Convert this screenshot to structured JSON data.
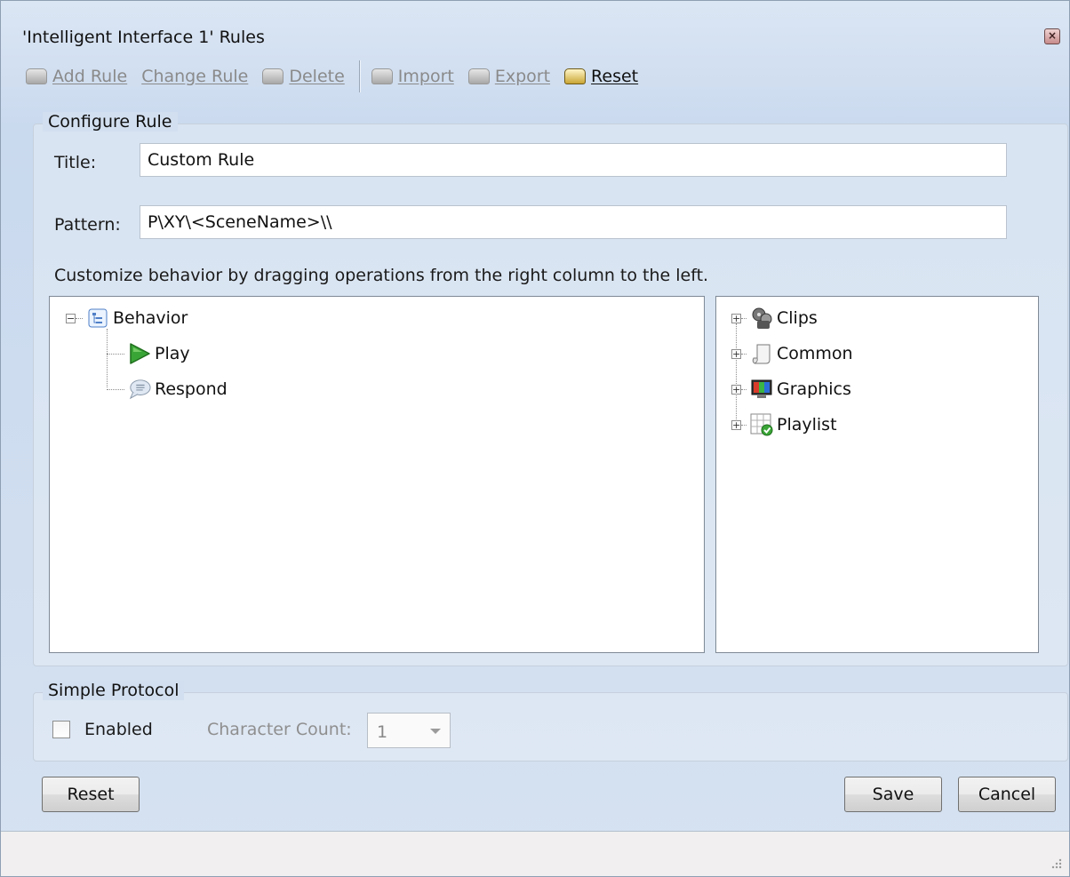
{
  "window": {
    "title": "'Intelligent Interface 1' Rules"
  },
  "toolbar": {
    "add_rule": "Add Rule",
    "change_rule": "Change Rule",
    "delete": "Delete",
    "import": "Import",
    "export": "Export",
    "reset": "Reset"
  },
  "configure": {
    "group_label": "Configure Rule",
    "title_label": "Title:",
    "title_value": "Custom Rule",
    "pattern_label": "Pattern:",
    "pattern_value": "P\\XY\\<SceneName>\\\\",
    "hint": "Customize behavior by dragging operations from the right column to the left."
  },
  "behavior_tree": {
    "root": {
      "label": "Behavior",
      "icon": "behavior-icon"
    },
    "children": [
      {
        "label": "Play",
        "icon": "play-icon"
      },
      {
        "label": "Respond",
        "icon": "speech-bubble-icon"
      }
    ]
  },
  "operations_tree": {
    "items": [
      {
        "label": "Clips",
        "icon": "film-reel-icon"
      },
      {
        "label": "Common",
        "icon": "scroll-icon"
      },
      {
        "label": "Graphics",
        "icon": "monitor-icon"
      },
      {
        "label": "Playlist",
        "icon": "playlist-grid-icon"
      }
    ]
  },
  "simple_protocol": {
    "group_label": "Simple Protocol",
    "enabled_label": "Enabled",
    "enabled": false,
    "char_count_label": "Character Count:",
    "char_count_value": "1"
  },
  "buttons": {
    "reset": "Reset",
    "save": "Save",
    "cancel": "Cancel"
  },
  "colors": {
    "frame": "#c9d9ee",
    "panel": "#ffffff",
    "border": "#7f8a96"
  }
}
